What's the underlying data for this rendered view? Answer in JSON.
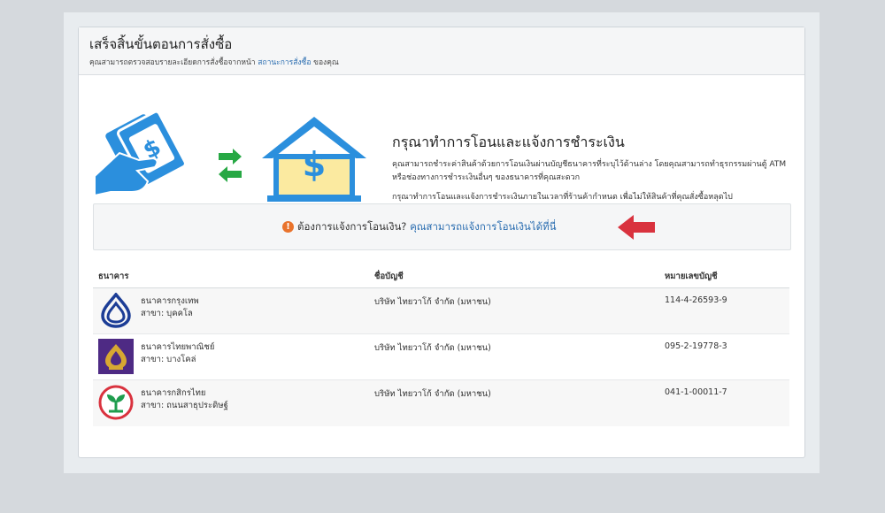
{
  "header": {
    "title": "เสร็จสิ้นขั้นตอนการสั่งซื้อ",
    "subtitle_before": "คุณสามารถตรวจสอบรายละเอียดการสั่งซื้อจากหน้า",
    "subtitle_link": "สถานะการสั่งซื้อ",
    "subtitle_after": "ของคุณ"
  },
  "hero": {
    "title": "กรุณาทำการโอนและแจ้งการชำระเงิน",
    "para1": "คุณสามารถชำระค่าสินค้าด้วยการโอนเงินผ่านบัญชีธนาคารที่ระบุไว้ด้านล่าง โดยคุณสามารถทำธุรกรรมผ่านตู้ ATM หรือช่องทางการชำระเงินอื่นๆ ของธนาคารที่คุณสะดวก",
    "para2": "กรุณาทำการโอนและแจ้งการชำระเงินภายในเวลาที่ร้านค้ากำหนด เพื่อไม่ให้สินค้าที่คุณสั่งซื้อหลุดไป"
  },
  "notice": {
    "question": "ต้องการแจ้งการโอนเงิน?",
    "link": "คุณสามารถแจ้งการโอนเงินได้ที่นี่"
  },
  "table": {
    "headers": [
      "ธนาคาร",
      "ชื่อบัญชี",
      "หมายเลขบัญชี"
    ],
    "rows": [
      {
        "bank": "ธนาคารกรุงเทพ",
        "branch": "สาขา: บุคคโล",
        "account_name": "บริษัท ไทยวาโก้ จำกัด (มหาชน)",
        "account_no": "114-4-26593-9",
        "logo": "bangkok-bank-logo"
      },
      {
        "bank": "ธนาคารไทยพาณิชย์",
        "branch": "สาขา: บางโคล่",
        "account_name": "บริษัท ไทยวาโก้ จำกัด (มหาชน)",
        "account_no": "095-2-19778-3",
        "logo": "scb-logo"
      },
      {
        "bank": "ธนาคารกสิกรไทย",
        "branch": "สาขา: ถนนสาธุประดิษฐ์",
        "account_name": "บริษัท ไทยวาโก้ จำกัด (มหาชน)",
        "account_no": "041-1-00011-7",
        "logo": "kasikorn-logo"
      }
    ]
  },
  "colors": {
    "link": "#2a6db0",
    "accent_blue": "#2b8fdd",
    "arrow_red": "#d9323e",
    "arrow_green": "#27a844",
    "info_orange": "#e9732c"
  }
}
